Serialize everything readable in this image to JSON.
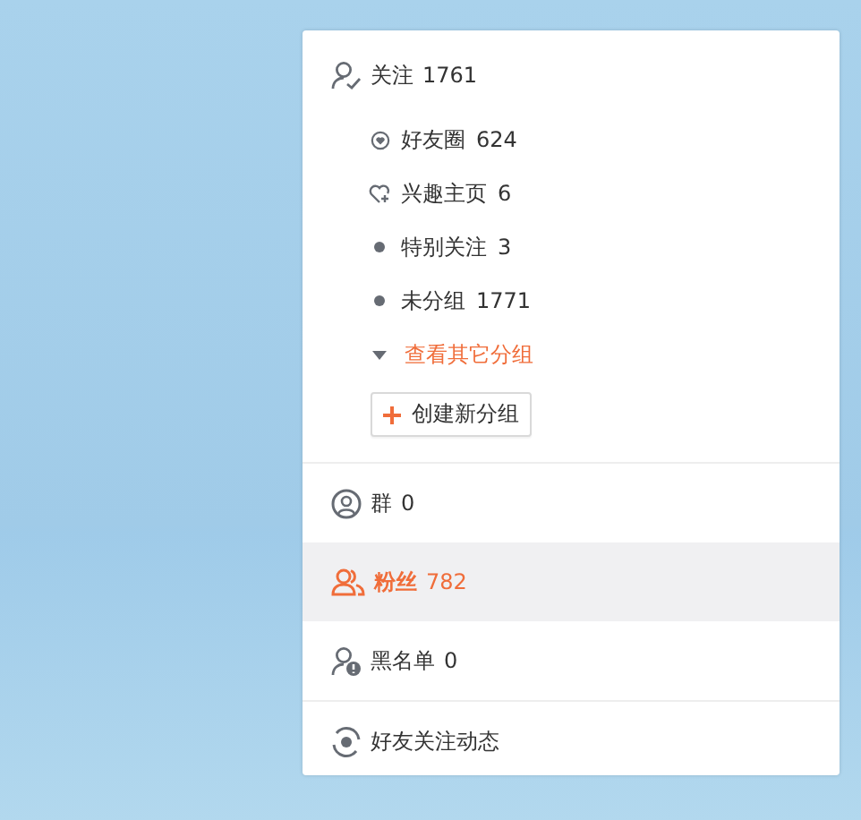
{
  "follow": {
    "label": "关注",
    "count": "1761",
    "groups": [
      {
        "kind": "heart-circle",
        "label": "好友圈",
        "count": "624"
      },
      {
        "kind": "heart-plus",
        "label": "兴趣主页",
        "count": "6"
      },
      {
        "kind": "dot",
        "label": "特别关注",
        "count": "3"
      },
      {
        "kind": "dot",
        "label": "未分组",
        "count": "1771"
      }
    ],
    "more_link": "查看其它分组",
    "create_button": "创建新分组"
  },
  "nav": [
    {
      "kind": "group",
      "label": "群",
      "count": "0",
      "selected": false
    },
    {
      "kind": "fans",
      "label": "粉丝",
      "count": "782",
      "selected": true
    },
    {
      "kind": "blacklist",
      "label": "黑名单",
      "count": "0",
      "selected": false
    }
  ],
  "feed": {
    "label": "好友关注动态"
  }
}
